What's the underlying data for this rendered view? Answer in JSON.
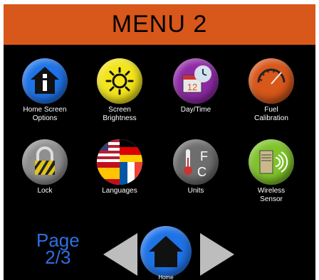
{
  "header": {
    "title": "MENU 2"
  },
  "tiles": [
    {
      "label": "Home Screen\nOptions",
      "icon": "home-info-icon",
      "color": "#1f73e8"
    },
    {
      "label": "Screen\nBrightness",
      "icon": "sun-icon",
      "color": "#f2e51b"
    },
    {
      "label": "Day/Time",
      "icon": "calendar-clock-icon",
      "color": "#8e2aa6"
    },
    {
      "label": "Fuel\nCalibration",
      "icon": "gauge-icon",
      "color": "#d8571a"
    },
    {
      "label": "Lock",
      "icon": "padlock-icon",
      "color": "#8f8f8f"
    },
    {
      "label": "Languages",
      "icon": "flags-icon",
      "color": "#ffffff"
    },
    {
      "label": "Units",
      "icon": "thermometer-units-icon",
      "color": "#6e6e6e"
    },
    {
      "label": "Wireless\nSensor",
      "icon": "wireless-sensor-icon",
      "color": "#7fc32a"
    }
  ],
  "pager": {
    "label": "Page\n2/3"
  },
  "nav": {
    "home_label": "Home",
    "prev_icon": "left-arrow-icon",
    "next_icon": "right-arrow-icon"
  }
}
